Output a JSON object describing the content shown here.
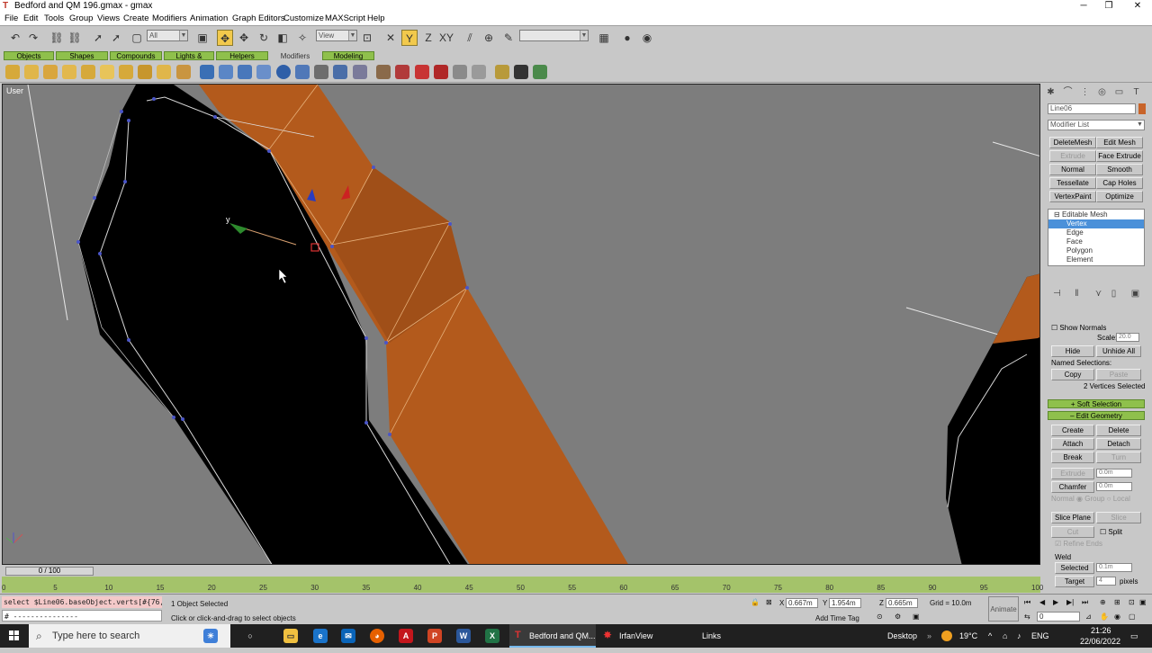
{
  "window": {
    "title": "Bedford and QM 196.gmax - gmax",
    "minimize": "─",
    "maximize": "❐",
    "close": "✕"
  },
  "menu": [
    "File",
    "Edit",
    "Tools",
    "Group",
    "Views",
    "Create",
    "Modifiers",
    "Animation",
    "Graph Editors",
    "Customize",
    "MAXScript",
    "Help"
  ],
  "toolbar": {
    "selection_filter": "All",
    "ref_coord": "View",
    "named_selection": ""
  },
  "tabs": [
    "Objects",
    "Shapes",
    "Compounds",
    "Lights & Cameras",
    "Helpers",
    "Modifiers",
    "Modeling"
  ],
  "active_tab": "Modifiers",
  "viewport": {
    "label": "User",
    "axis_y": "y",
    "mesh_color": "#b85f1f"
  },
  "command_panel": {
    "object_name": "Line06",
    "object_color": "#c8642a",
    "modifier_list": "Modifier List",
    "modifier_buttons": [
      {
        "label": "DeleteMesh",
        "enabled": true
      },
      {
        "label": "Edit Mesh",
        "enabled": true
      },
      {
        "label": "Extrude",
        "enabled": false
      },
      {
        "label": "Face Extrude",
        "enabled": true
      },
      {
        "label": "Normal",
        "enabled": true
      },
      {
        "label": "Smooth",
        "enabled": true
      },
      {
        "label": "Tessellate",
        "enabled": true
      },
      {
        "label": "Cap Holes",
        "enabled": true
      },
      {
        "label": "VertexPaint",
        "enabled": true
      },
      {
        "label": "Optimize",
        "enabled": true
      }
    ],
    "stack": {
      "root": "Editable Mesh",
      "items": [
        "Vertex",
        "Edge",
        "Face",
        "Polygon",
        "Element"
      ],
      "selected": "Vertex"
    },
    "selection": {
      "show_normals": "Show Normals",
      "scale_label": "Scale:",
      "scale_value": "20.0",
      "hide": "Hide",
      "unhide_all": "Unhide All",
      "named_selections": "Named Selections:",
      "copy": "Copy",
      "paste": "Paste",
      "status": "2 Vertices Selected"
    },
    "rollouts": {
      "soft_selection": "Soft Selection",
      "edit_geometry": "Edit Geometry"
    },
    "edit_geometry": {
      "create": "Create",
      "delete": "Delete",
      "attach": "Attach",
      "detach": "Detach",
      "break": "Break",
      "turn": "Turn",
      "extrude": "Extrude",
      "extrude_value": "0.0m",
      "chamfer": "Chamfer",
      "chamfer_value": "0.0m",
      "normal": "Normal",
      "group": "Group",
      "local": "Local",
      "slice_plane": "Slice Plane",
      "slice": "Slice",
      "cut": "Cut",
      "split": "Split",
      "refine_ends": "Refine Ends",
      "weld": "Weld",
      "selected": "Selected",
      "selected_value": "0.1m",
      "target": "Target",
      "target_value": "4",
      "pixels": "pixels"
    }
  },
  "timeline": {
    "slider": "0 / 100",
    "ticks": [
      "0",
      "5",
      "10",
      "15",
      "20",
      "25",
      "30",
      "35",
      "40",
      "45",
      "50",
      "55",
      "60",
      "65",
      "70",
      "75",
      "80",
      "85",
      "90",
      "95",
      "100"
    ]
  },
  "status": {
    "maxscript_line": "select $Line06.baseObject.verts[#{76,",
    "maxscript_input": "# ---------------",
    "selection": "1 Object Selected",
    "prompt": "Click or click-and-drag to select objects",
    "x": "0.667m",
    "y": "1.954m",
    "z": "0.665m",
    "grid": "Grid = 10.0m",
    "add_time_tag": "Add Time Tag",
    "animate": "Animate",
    "frame": "0"
  },
  "taskbar": {
    "search_placeholder": "Type here to search",
    "apps": [
      {
        "label": "Bedford and QM...",
        "active": true
      },
      {
        "label": "IrfanView",
        "active": false
      },
      {
        "label": "Links",
        "active": false
      }
    ],
    "desktop": "Desktop",
    "temperature": "19°C",
    "language": "ENG",
    "time": "21:26",
    "date": "22/06/2022"
  }
}
